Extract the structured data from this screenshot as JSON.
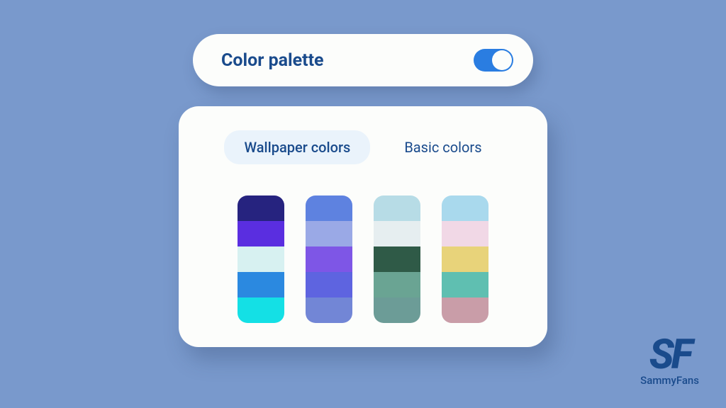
{
  "header": {
    "title": "Color palette",
    "toggle_on": true
  },
  "tabs": {
    "wallpaper": "Wallpaper colors",
    "basic": "Basic colors"
  },
  "palettes": [
    [
      "#26237f",
      "#5a2ee0",
      "#d7f1f1",
      "#2b89e0",
      "#14e0e5"
    ],
    [
      "#5e82e0",
      "#9aa9e6",
      "#7e56e6",
      "#5e64e0",
      "#7286d6"
    ],
    [
      "#b7dce6",
      "#e6eef0",
      "#2f5a47",
      "#6aa493",
      "#6c9c97"
    ],
    [
      "#a9d9ed",
      "#f1d8e6",
      "#e8d37a",
      "#5fbfb1",
      "#c99da8"
    ]
  ],
  "watermark": {
    "logo": "SF",
    "text": "SammyFans"
  }
}
